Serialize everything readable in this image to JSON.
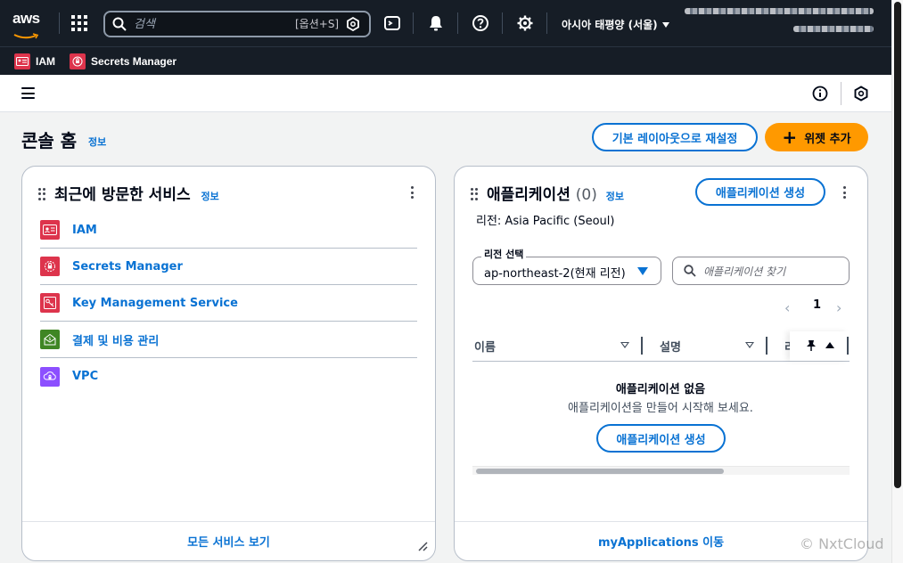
{
  "nav": {
    "logo": "aws",
    "search_placeholder": "검색",
    "search_shortcut": "[옵션+S]",
    "region": "아시아 태평양 (서울)",
    "icons": [
      "services-grid-icon",
      "search-icon",
      "amazon-q-icon",
      "cloudshell-icon",
      "notifications-bell-icon",
      "help-icon",
      "settings-gear-icon",
      "caret-down-icon"
    ]
  },
  "favorites": [
    {
      "label": "IAM",
      "icon": "iam-service-icon",
      "color": "#dd344c"
    },
    {
      "label": "Secrets Manager",
      "icon": "secrets-manager-service-icon",
      "color": "#dd344c"
    }
  ],
  "toolbar": {
    "icons": [
      "menu-hamburger-icon",
      "info-circle-icon",
      "amazon-q-icon"
    ]
  },
  "page": {
    "title": "콘솔 홈",
    "info": "정보",
    "reset_layout_button": "기본 레이아웃으로 재설정",
    "add_widget_button": "위젯 추가"
  },
  "recent_services": {
    "title": "최근에 방문한 서비스",
    "info": "정보",
    "items": [
      {
        "label": "IAM",
        "icon": "iam-icon",
        "color": "#dd344c"
      },
      {
        "label": "Secrets Manager",
        "icon": "secrets-manager-icon",
        "color": "#dd344c"
      },
      {
        "label": "Key Management Service",
        "icon": "kms-icon",
        "color": "#dd344c"
      },
      {
        "label": "결제 및 비용 관리",
        "icon": "billing-icon",
        "color": "#3f8624"
      },
      {
        "label": "VPC",
        "icon": "vpc-icon",
        "color": "#8c4fff"
      }
    ],
    "footer_link": "모든 서비스 보기"
  },
  "applications": {
    "title": "애플리케이션",
    "count": "(0)",
    "info": "정보",
    "create_button": "애플리케이션 생성",
    "region_text": "리전: Asia Pacific (Seoul)",
    "region_select_label": "리전 선택",
    "region_select_value": "ap-northeast-2(현재 리전)",
    "search_placeholder": "애플리케이션 찾기",
    "page_number": "1",
    "columns": [
      "이름",
      "설명",
      "리"
    ],
    "empty_title": "애플리케이션 없음",
    "empty_desc": "애플리케이션을 만들어 시작해 보세요.",
    "empty_create_button": "애플리케이션 생성",
    "footer_link": "myApplications 이동"
  },
  "watermark": "© NxtCloud",
  "colors": {
    "nav_bg": "#161d26",
    "link": "#0972d3",
    "primary": "#ff9900",
    "security_red": "#dd344c",
    "billing_green": "#3f8624",
    "vpc_purple": "#8c4fff"
  }
}
